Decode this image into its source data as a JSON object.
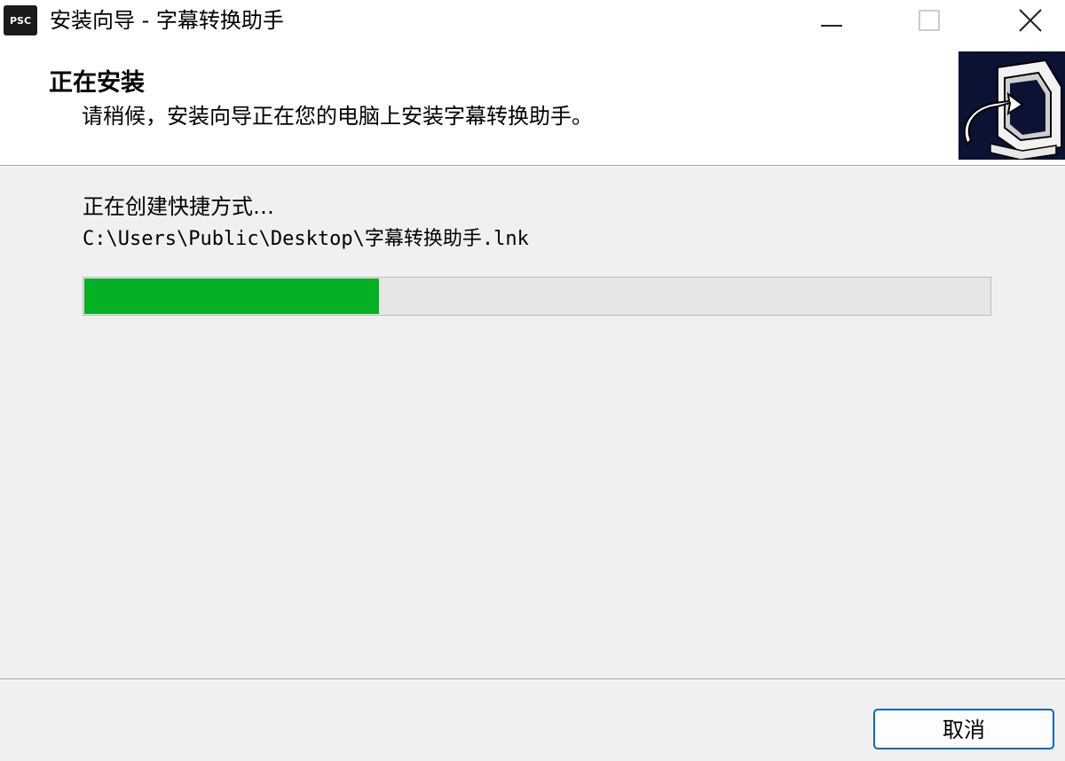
{
  "window": {
    "icon_text": "PSC",
    "title": "安装向导 - 字幕转换助手",
    "icons": [
      "minimize-icon",
      "maximize-icon",
      "close-icon"
    ]
  },
  "header": {
    "title": "正在安装",
    "subtitle": "请稍候，安装向导正在您的电脑上安装字幕转换助手。",
    "graphic": "installer-computer-icon"
  },
  "status": {
    "action": "正在创建快捷方式…",
    "path": "C:\\Users\\Public\\Desktop\\字幕转换助手.lnk"
  },
  "progress": {
    "fraction": 0.325,
    "color": "#06b025"
  },
  "buttons": {
    "cancel_label": "取消"
  }
}
